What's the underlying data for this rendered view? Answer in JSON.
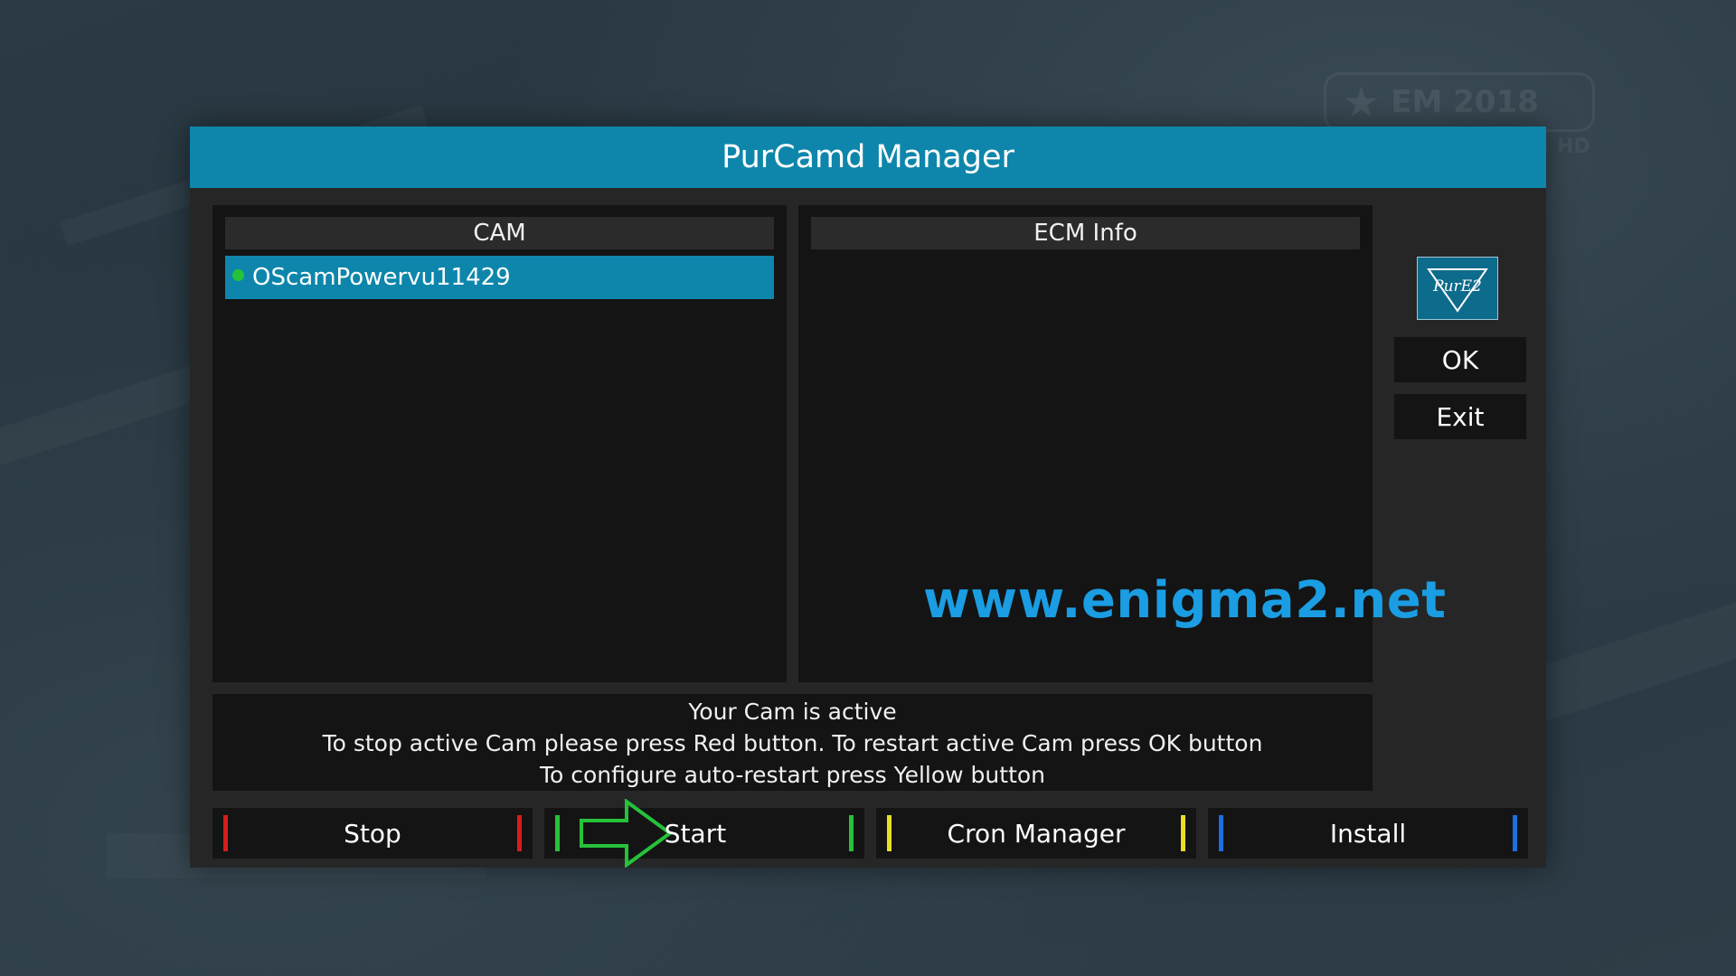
{
  "window": {
    "title": "PurCamd Manager"
  },
  "background": {
    "channel_logo_text": "EM 2018",
    "channel_logo_sub": "HD"
  },
  "cam_panel": {
    "header": "CAM",
    "items": [
      {
        "label": "OScamPowervu11429",
        "status": "active"
      }
    ]
  },
  "ecm_panel": {
    "header": "ECM Info"
  },
  "watermark": "www.enigma2.net",
  "side": {
    "logo_text": "PurE2",
    "ok_label": "OK",
    "exit_label": "Exit"
  },
  "info": {
    "line1": "Your Cam is active",
    "line2": "To stop active Cam please press Red button. To restart active Cam press OK button",
    "line3": "To configure auto-restart press Yellow button"
  },
  "buttons": {
    "stop": {
      "label": "Stop",
      "color": "#d81c1c"
    },
    "start": {
      "label": "Start",
      "color": "#26c23a"
    },
    "cron": {
      "label": "Cron Manager",
      "color": "#e8e020"
    },
    "install": {
      "label": "Install",
      "color": "#1c6fe0"
    }
  },
  "colors": {
    "accent": "#0e86ab",
    "active_dot": "#26c23a",
    "watermark": "#1a9de3"
  }
}
